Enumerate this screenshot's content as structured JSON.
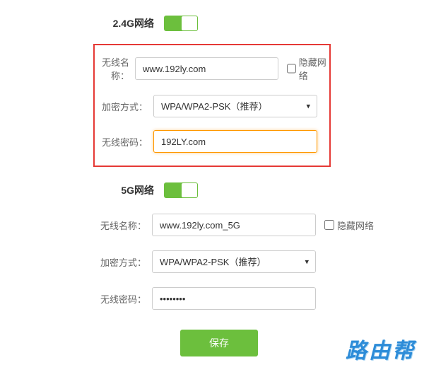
{
  "sections": {
    "s24g": {
      "title": "2.4G网络",
      "name_label": "无线名称：",
      "name_value": "www.192ly.com",
      "hide_label": "隐藏网络",
      "enc_label": "加密方式：",
      "enc_value": "WPA/WPA2-PSK（推荐）",
      "pwd_label": "无线密码：",
      "pwd_value": "192LY.com"
    },
    "s5g": {
      "title": "5G网络",
      "name_label": "无线名称：",
      "name_value": "www.192ly.com_5G",
      "hide_label": "隐藏网络",
      "enc_label": "加密方式：",
      "enc_value": "WPA/WPA2-PSK（推荐）",
      "pwd_label": "无线密码：",
      "pwd_value": "••••••••"
    }
  },
  "save_label": "保存",
  "watermark": "路由帮"
}
